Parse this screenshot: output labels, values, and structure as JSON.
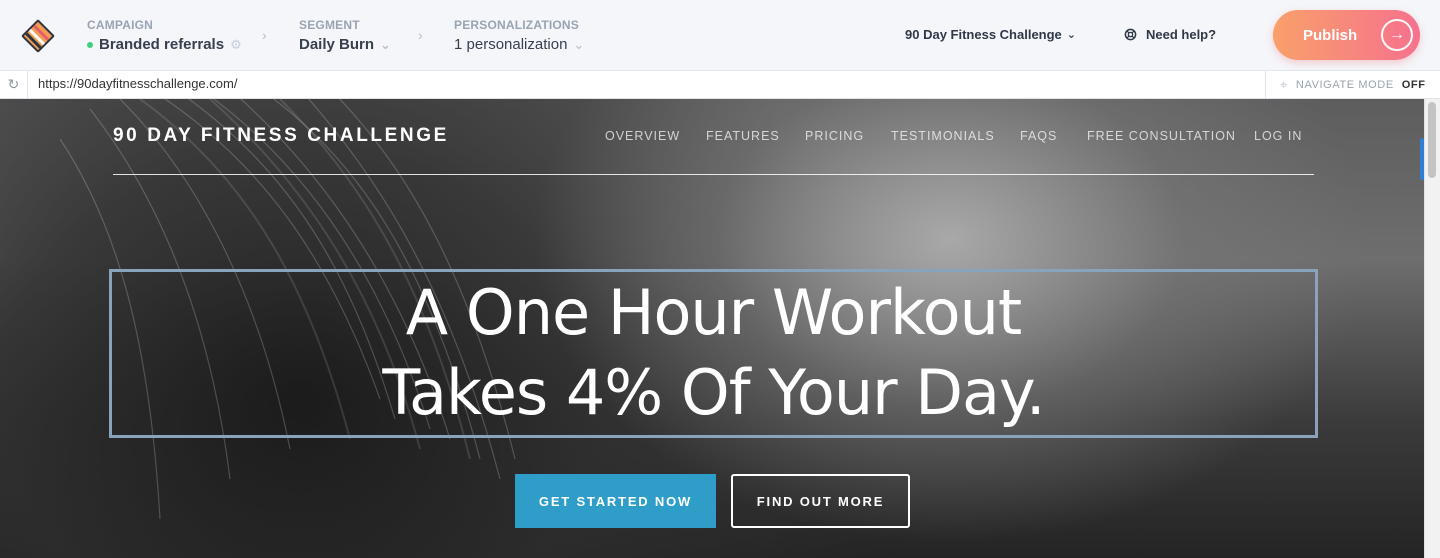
{
  "topbar": {
    "breadcrumbs": [
      {
        "label": "CAMPAIGN",
        "value": "Branded referrals"
      },
      {
        "label": "SEGMENT",
        "value": "Daily Burn"
      },
      {
        "label": "PERSONALIZATIONS",
        "value": "1 personalization"
      }
    ],
    "campaign_selector": "90 Day Fitness Challenge",
    "help_label": "Need help?",
    "publish_label": "Publish"
  },
  "urlbar": {
    "url": "https://90dayfitnesschallenge.com/",
    "navigate_mode_label": "NAVIGATE MODE",
    "navigate_mode_state": "OFF"
  },
  "site": {
    "title": "90 DAY FITNESS CHALLENGE",
    "nav": [
      "OVERVIEW",
      "FEATURES",
      "PRICING",
      "TESTIMONIALS",
      "FAQS",
      "FREE CONSULTATION",
      "LOG IN"
    ],
    "headline_line1": "A One Hour Workout",
    "headline_line2": "Takes 4% Of Your Day.",
    "primary_cta": "GET STARTED NOW",
    "secondary_cta": "FIND OUT MORE"
  },
  "colors": {
    "status_active": "#3fcf7a",
    "publish_gradient_start": "#f8a06a",
    "publish_gradient_end": "#f6718e",
    "cta_primary": "#2e9ec9",
    "headline_box_border": "#8aa3bc",
    "scroll_marker": "#2f7fd4"
  },
  "icons": {
    "logo": "stacked-layers-logo",
    "campaign_settings": "gear-icon",
    "dropdown": "chevron-down-icon",
    "breadcrumb_separator": "chevron-right-icon",
    "help": "lifebuoy-icon",
    "publish": "arrow-right-circle-icon",
    "refresh": "refresh-icon",
    "navigate_mode": "crosshair-icon"
  }
}
